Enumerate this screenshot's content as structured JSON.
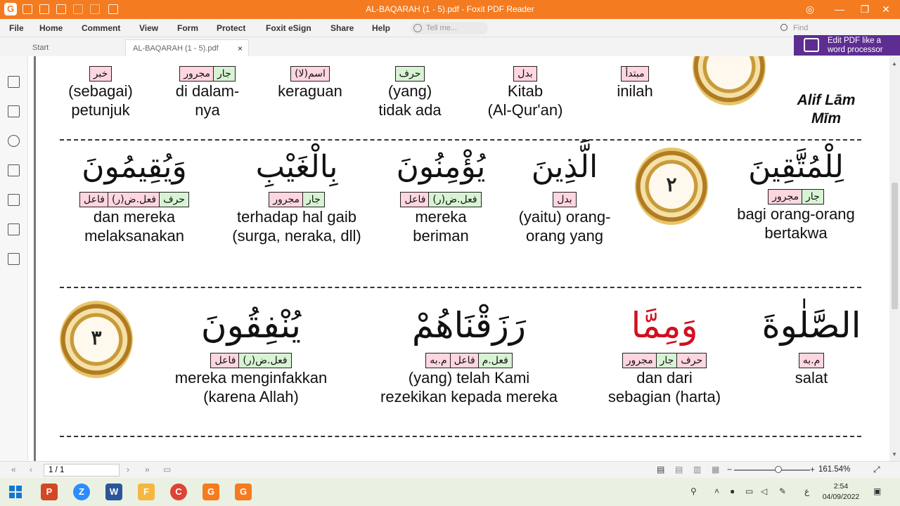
{
  "window": {
    "title": "AL-BAQARAH (1 - 5).pdf - Foxit PDF Reader",
    "controls": {
      "minimize": "—",
      "restore": "❐",
      "close": "✕"
    }
  },
  "menu": {
    "items": [
      "File",
      "Home",
      "Comment",
      "View",
      "Form",
      "Protect",
      "Foxit eSign",
      "Share",
      "Help"
    ],
    "tell_me_placeholder": "Tell me...",
    "find_placeholder": "Find"
  },
  "tabs": [
    {
      "label": "Start"
    },
    {
      "label": "AL-BAQARAH (1 - 5).pdf",
      "close": "×"
    }
  ],
  "promo": {
    "line1": "Edit PDF like a",
    "line2": "word processor"
  },
  "page": {
    "row1": [
      {
        "tags": [
          {
            "t": "خبر",
            "c": "pink"
          }
        ],
        "gloss": [
          "(sebagai)",
          "petunjuk"
        ]
      },
      {
        "tags": [
          {
            "t": "مجرور",
            "c": "pink"
          },
          {
            "t": "جار",
            "c": "green"
          }
        ],
        "gloss": [
          "di dalam-",
          "nya"
        ]
      },
      {
        "tags": [
          {
            "t": "اسم(لا)",
            "c": "pink"
          }
        ],
        "gloss": [
          "keraguan"
        ]
      },
      {
        "tags": [
          {
            "t": "حرف",
            "c": "green"
          }
        ],
        "gloss": [
          "(yang)",
          "tidak ada"
        ]
      },
      {
        "tags": [
          {
            "t": "بدل",
            "c": "pink"
          }
        ],
        "gloss": [
          "Kitab",
          "(Al-Qur'an)"
        ]
      },
      {
        "tags": [
          {
            "t": "مبتدأ",
            "c": "pink"
          }
        ],
        "gloss": [
          "inilah"
        ]
      },
      {
        "tags": [],
        "gloss": [
          "Alif Lām",
          "Mīm"
        ],
        "italic": true
      }
    ],
    "row2": [
      {
        "arabic": "وَيُقِيمُونَ",
        "tags": [
          {
            "t": "فاعل",
            "c": "pink"
          },
          {
            "t": "فعل.ض(ر)",
            "c": "pink"
          },
          {
            "t": "حرف",
            "c": "green"
          }
        ],
        "gloss": [
          "dan mereka",
          "melaksanakan"
        ]
      },
      {
        "arabic": "بِالْغَيْبِ",
        "tags": [
          {
            "t": "مجرور",
            "c": "pink"
          },
          {
            "t": "جار",
            "c": "green"
          }
        ],
        "gloss": [
          "terhadap hal gaib",
          "(surga, neraka, dll)"
        ]
      },
      {
        "arabic": "يُؤْمِنُونَ",
        "tags": [
          {
            "t": "فاعل",
            "c": "pink"
          },
          {
            "t": "فعل.ض(ر)",
            "c": "green"
          }
        ],
        "gloss": [
          "mereka",
          "beriman"
        ]
      },
      {
        "arabic": "الَّذِينَ",
        "tags": [
          {
            "t": "بدل",
            "c": "pink"
          }
        ],
        "gloss": [
          "(yaitu) orang-",
          "orang yang"
        ]
      },
      {
        "arabic": "لِلْمُتَّقِينَ",
        "tags": [
          {
            "t": "مجرور",
            "c": "pink"
          },
          {
            "t": "جار",
            "c": "green"
          }
        ],
        "gloss": [
          "bagi orang-orang",
          "bertakwa"
        ]
      }
    ],
    "row3": [
      {
        "arabic": "يُنْفِقُونَ",
        "tags": [
          {
            "t": "فاعل",
            "c": "pink"
          },
          {
            "t": "فعل.ض(ر)",
            "c": "green"
          }
        ],
        "gloss": [
          "mereka menginfakkan",
          "(karena Allah)"
        ]
      },
      {
        "arabic": "رَزَقْنَاهُمْ",
        "tags": [
          {
            "t": "م.به",
            "c": "pink"
          },
          {
            "t": "فاعل",
            "c": "pink"
          },
          {
            "t": "فعل.م",
            "c": "green"
          }
        ],
        "gloss": [
          "(yang) telah Kami",
          "rezekikan kepada mereka"
        ]
      },
      {
        "arabic": "وَمِمَّا",
        "tags": [
          {
            "t": "مجرور",
            "c": "pink"
          },
          {
            "t": "جار",
            "c": "green"
          },
          {
            "t": "حرف",
            "c": "pink"
          }
        ],
        "gloss": [
          "dan dari",
          "sebagian (harta)"
        ]
      },
      {
        "arabic": "الصَّلٰوةَ",
        "tags": [
          {
            "t": "م.به",
            "c": "pink"
          }
        ],
        "gloss": [
          "salat"
        ]
      }
    ],
    "verse_numbers": [
      "٢",
      "٣"
    ]
  },
  "nav": {
    "page": "1 / 1",
    "zoom": "161.54%"
  },
  "taskbar": {
    "apps": [
      {
        "label": "P",
        "color": "#d24726"
      },
      {
        "label": "Z",
        "color": "#2d8cff"
      },
      {
        "label": "W",
        "color": "#2b579a"
      },
      {
        "label": "F",
        "color": "#f5b642"
      },
      {
        "label": "C",
        "color": "#db4437"
      },
      {
        "label": "G",
        "color": "#f47b20"
      },
      {
        "label": "G",
        "color": "#f47b20"
      }
    ],
    "time": "2:54",
    "date": "04/09/2022"
  },
  "colors": {
    "accent": "#f47b20",
    "promo": "#5d2d91",
    "tag_pink": "#ffd6e0",
    "tag_green": "#d8f3d4"
  }
}
